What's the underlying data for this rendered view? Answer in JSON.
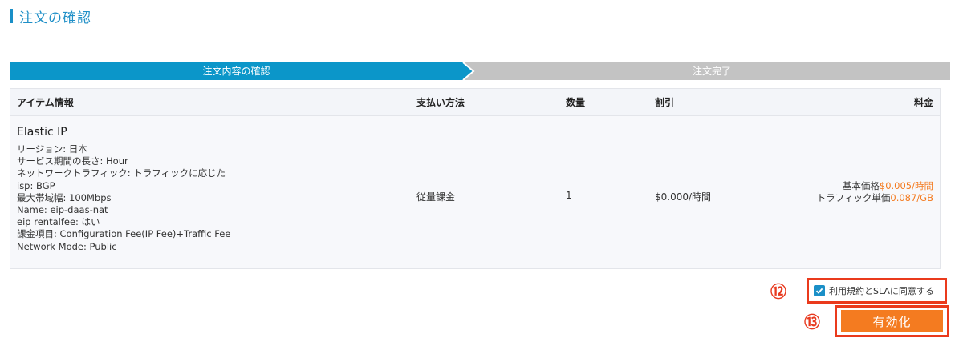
{
  "page": {
    "title": "注文の確認"
  },
  "steps": [
    {
      "label": "注文内容の確認",
      "state": "active"
    },
    {
      "label": "注文完了",
      "state": "inactive"
    }
  ],
  "table": {
    "headers": {
      "item": "アイテム情報",
      "payment": "支払い方法",
      "quantity": "数量",
      "discount": "割引",
      "fee": "料金"
    },
    "row": {
      "name": "Elastic IP",
      "details": [
        "リージョン: 日本",
        "サービス期間の長さ: Hour",
        "ネットワークトラフィック: トラフィックに応じた",
        "isp: BGP",
        "最大帯域幅: 100Mbps",
        "Name: eip-daas-nat",
        "eip rentalfee: はい",
        "課金項目: Configuration Fee(IP Fee)+Traffic Fee",
        "Network Mode: Public"
      ],
      "payment": "従量課金",
      "quantity": "1",
      "discount": "$0.000/時間",
      "fee": {
        "base_label": "基本価格",
        "base_value": "$0.005/時間",
        "traffic_label": "トラフィック単価",
        "traffic_value": "0.087/GB"
      }
    }
  },
  "annotations": {
    "n12": "⑫",
    "n13": "⑬"
  },
  "agreement": {
    "label": "利用規約とSLAに同意する",
    "checked": true
  },
  "activate_button": {
    "label": "有効化"
  },
  "colors": {
    "accent": "#1a8fc7",
    "step_active": "#0b96c9",
    "step_inactive": "#c3c3c3",
    "orange": "#f47b20",
    "highlight": "#ea3a1c"
  }
}
